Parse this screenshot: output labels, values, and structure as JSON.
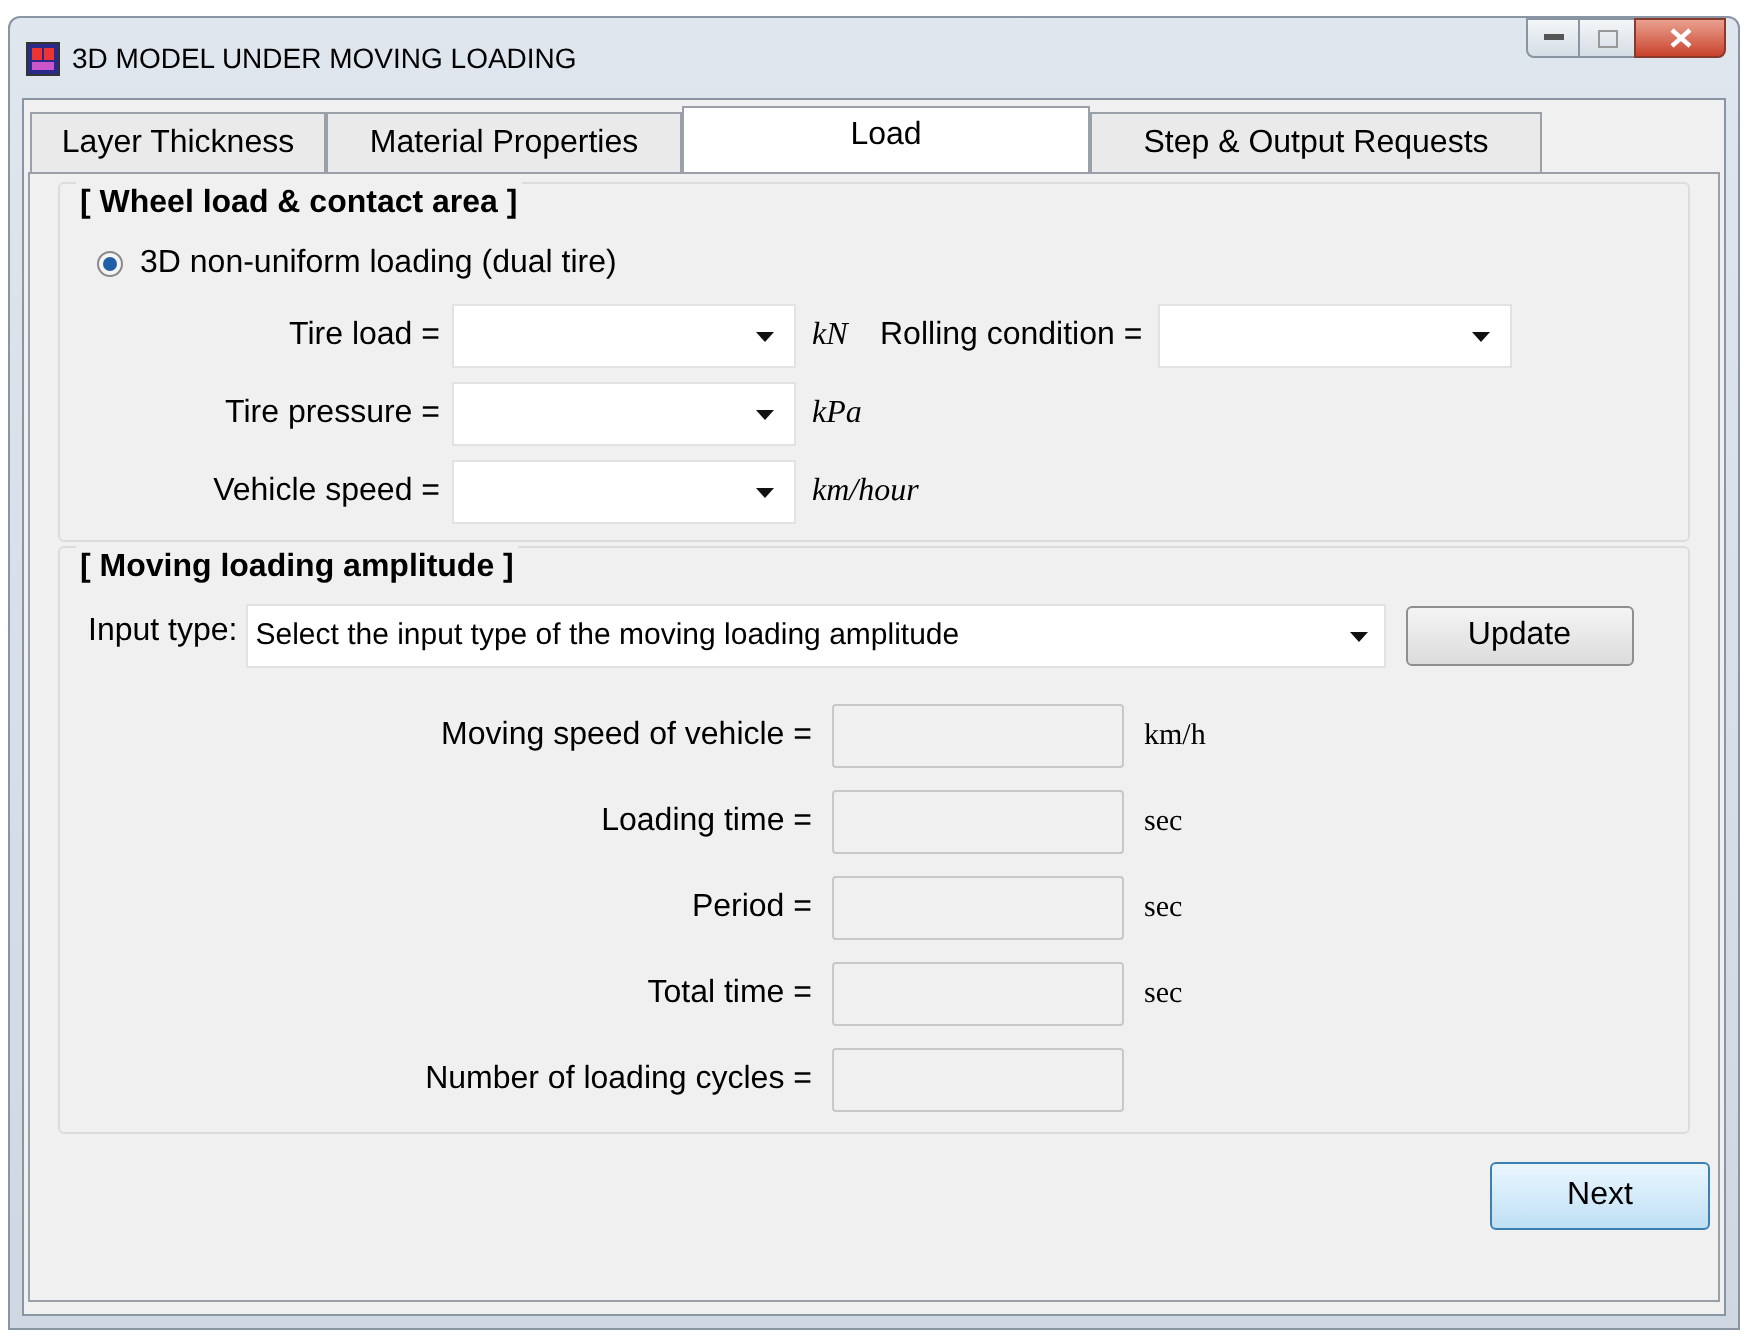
{
  "window": {
    "title": "3D MODEL UNDER MOVING LOADING"
  },
  "tabs": [
    {
      "label": "Layer Thickness",
      "selected": false
    },
    {
      "label": "Material Properties",
      "selected": false
    },
    {
      "label": "Load",
      "selected": true
    },
    {
      "label": "Step & Output Requests",
      "selected": false
    }
  ],
  "wheel_load_section": {
    "heading": "[ Wheel load & contact area ]",
    "radio": {
      "label": "3D non-uniform loading (dual tire)",
      "selected": true
    },
    "fields": [
      {
        "label": "Tire load =",
        "unit": "kN"
      },
      {
        "label": "Tire pressure =",
        "unit": "kPa"
      },
      {
        "label": "Vehicle speed =",
        "unit": "km/hour"
      }
    ],
    "rolling_condition": {
      "label": "Rolling condition ="
    }
  },
  "amplitude_section": {
    "heading": "[ Moving loading amplitude ]",
    "input_type": {
      "label": "Input type:",
      "value": "Select the input type of the moving loading amplitude"
    },
    "update_button": "Update",
    "fields": [
      {
        "label": "Moving speed of vehicle =",
        "unit": "km/h",
        "disabled": true
      },
      {
        "label": "Loading time =",
        "unit": "sec",
        "disabled": true
      },
      {
        "label": "Period =",
        "unit": "sec",
        "disabled": true
      },
      {
        "label": "Total time =",
        "unit": "sec",
        "disabled": true
      },
      {
        "label": "Number of loading cycles =",
        "disabled": true
      }
    ]
  },
  "next_button": "Next"
}
